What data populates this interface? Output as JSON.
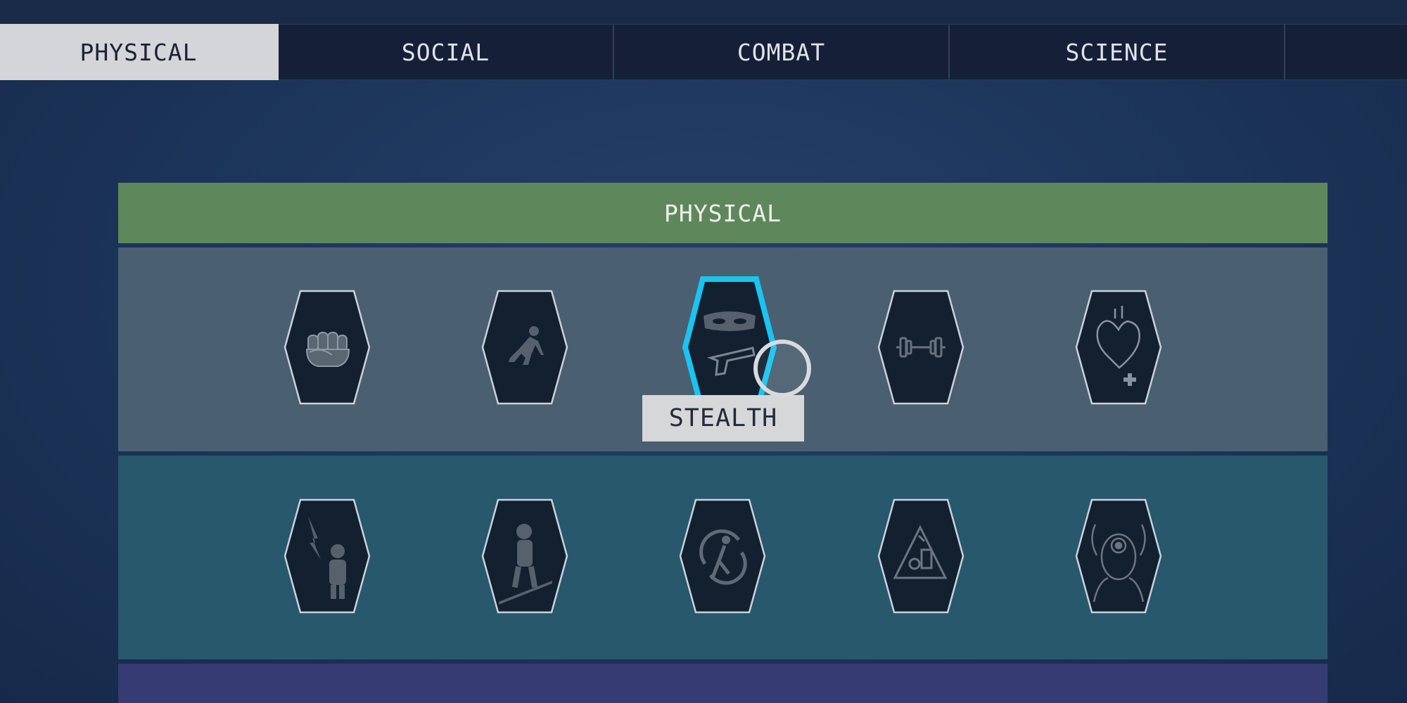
{
  "tabs": [
    {
      "label": "PHYSICAL",
      "active": true
    },
    {
      "label": "SOCIAL",
      "active": false
    },
    {
      "label": "COMBAT",
      "active": false
    },
    {
      "label": "SCIENCE",
      "active": false
    },
    {
      "label": "",
      "active": false
    }
  ],
  "category": {
    "title": "PHYSICAL",
    "color": "#5e885c"
  },
  "tier_colors": [
    "#4a5f70",
    "#27586c",
    "#363b74"
  ],
  "skills": {
    "row1": [
      {
        "icon": "fist-icon"
      },
      {
        "icon": "sprinter-icon"
      },
      {
        "icon": "stealth-mask-pistol-icon",
        "selected": true
      },
      {
        "icon": "dumbbell-icon"
      },
      {
        "icon": "heart-plus-icon"
      }
    ],
    "row2": [
      {
        "icon": "astronaut-lightning-icon"
      },
      {
        "icon": "astronaut-walking-icon"
      },
      {
        "icon": "dodging-figure-icon"
      },
      {
        "icon": "hazard-triangle-icon"
      },
      {
        "icon": "head-target-icon"
      }
    ]
  },
  "tooltip": {
    "label": "STEALTH"
  },
  "accent_color": "#19c4f0"
}
